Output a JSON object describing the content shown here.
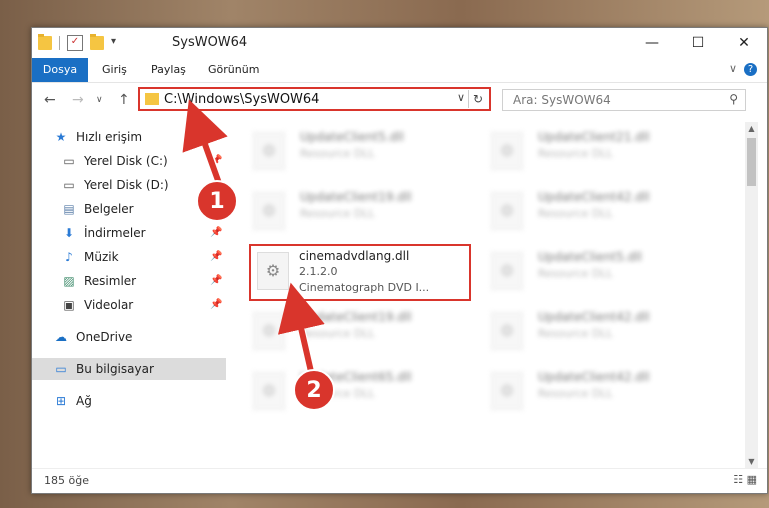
{
  "window": {
    "title": "SysWOW64",
    "minimize": "—",
    "maximize": "☐",
    "close": "✕"
  },
  "ribbon": {
    "tabs": [
      "Dosya",
      "Giriş",
      "Paylaş",
      "Görünüm"
    ],
    "expander": "∨",
    "help": "?"
  },
  "nav_buttons": {
    "back": "←",
    "forward": "→",
    "recent": "∨",
    "up": "↑"
  },
  "address": {
    "path": "C:\\Windows\\SysWOW64",
    "dropdown": "∨",
    "refresh": "↻"
  },
  "search": {
    "placeholder": "Ara: SysWOW64",
    "icon": "search-icon"
  },
  "sidebar": {
    "items": [
      {
        "label": "Hızlı erişim",
        "icon": "star-icon",
        "glyph": "★"
      },
      {
        "label": "Yerel Disk (C:)",
        "icon": "drive-icon",
        "glyph": "▭"
      },
      {
        "label": "Yerel Disk (D:)",
        "icon": "drive-icon",
        "glyph": "▭"
      },
      {
        "label": "Belgeler",
        "icon": "document-icon",
        "glyph": "▤"
      },
      {
        "label": "İndirmeler",
        "icon": "download-icon",
        "glyph": "⬇"
      },
      {
        "label": "Müzik",
        "icon": "music-icon",
        "glyph": "♪"
      },
      {
        "label": "Resimler",
        "icon": "picture-icon",
        "glyph": "▨"
      },
      {
        "label": "Videolar",
        "icon": "video-icon",
        "glyph": "▣"
      },
      {
        "label": "OneDrive",
        "icon": "cloud-icon",
        "glyph": "☁"
      },
      {
        "label": "Bu bilgisayar",
        "icon": "computer-icon",
        "glyph": "▭"
      },
      {
        "label": "Ağ",
        "icon": "network-icon",
        "glyph": "⊞"
      }
    ],
    "pin": "📌"
  },
  "files": {
    "left": [
      {
        "name": "UpdateClient5.dll",
        "type": "Resource DLL"
      },
      {
        "name": "UpdateClient19.dll",
        "type": "Resource DLL"
      },
      {
        "name": "UpdateClient19.dll",
        "type": "Resource DLL"
      },
      {
        "name": "UpdateClient65.dll",
        "type": "Resource DLL"
      }
    ],
    "highlighted": {
      "name": "cinemadvdlang.dll",
      "version": "2.1.2.0",
      "desc": "Cinematograph DVD I..."
    },
    "right": [
      {
        "name": "UpdateClient21.dll",
        "type": "Resource DLL"
      },
      {
        "name": "UpdateClient42.dll",
        "type": "Resource DLL"
      },
      {
        "name": "UpdateClient5.dll",
        "type": "Resource DLL"
      },
      {
        "name": "UpdateClient42.dll",
        "type": "Resource DLL"
      },
      {
        "name": "UpdateClient42.dll",
        "type": "Resource DLL"
      }
    ]
  },
  "status": {
    "count": "185 öğe",
    "views": "☷ ▦"
  },
  "markers": [
    "1",
    "2"
  ],
  "colors": {
    "accent": "#1a6fc4",
    "highlight": "#d9352c"
  }
}
